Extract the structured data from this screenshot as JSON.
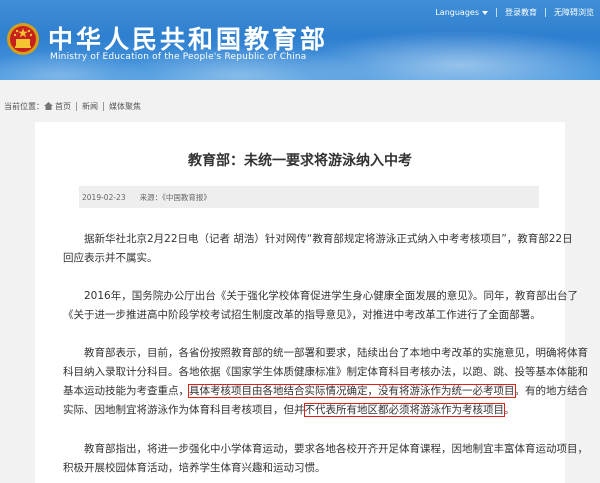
{
  "header": {
    "site_title": "中华人民共和国教育部",
    "site_subtitle": "Ministry of Education of the People's Republic of China",
    "languages_label": "Languages",
    "links": [
      "登录教育",
      "无障碍浏览"
    ]
  },
  "breadcrumb": {
    "prefix": "当前位置：",
    "items": [
      "首页",
      "新闻",
      "媒体聚焦"
    ]
  },
  "article": {
    "title": "教育部：未统一要求将游泳纳入中考",
    "date": "2019-02-23",
    "source": "来源：《中国教育报》",
    "paragraphs": [
      {
        "lines": [
          "据新华社北京2月22日电（记者 胡浩）针对网传“教育部规定将游泳正式纳入中考考核项目”，教育部22日",
          "回应表示并不属实。"
        ]
      },
      {
        "lines": [
          "2016年，国务院办公厅出台《关于强化学校体育促进学生身心健康全面发展的意见》。同年，教育部出台了",
          "《关于进一步推进高中阶段学校考试招生制度改革的指导意见》，对推进中考改革工作进行了全面部署。"
        ]
      },
      {
        "line1": "教育部表示，目前，各省份按照教育部的统一部署和要求，陆续出台了本地中考改革的实施意见，明确将体育",
        "line2": "科目纳入录取计分科目。各地依据《国家学生体质健康标准》制定体育科目考核办法，以跑、跳、投等基本体能和",
        "line3_a": "基本运动技能为考查重点，",
        "line3_hl": "具体考核项目由各地结合实际情况确定，没有将游泳作为统一必考项目",
        "line3_b": "。有的地方结合",
        "line4_a": "实际、因地制宜将游泳作为体育科目考核项目，但并",
        "line4_hl": "不代表所有地区都必须将游泳作为考核项目",
        "line4_b": "。"
      },
      {
        "lines": [
          "教育部指出，将进一步强化中小学体育运动，要求各地各校开齐开足体育课程，因地制宜丰富体育运动项目，",
          "积极开展校园体育活动，培养学生体育兴趣和运动习惯。"
        ]
      }
    ]
  },
  "colors": {
    "header_blue": "#2f7fd0",
    "highlight_red": "#e0201b",
    "meta_bg": "#eeeeee",
    "page_bg": "#f2f2f2"
  }
}
